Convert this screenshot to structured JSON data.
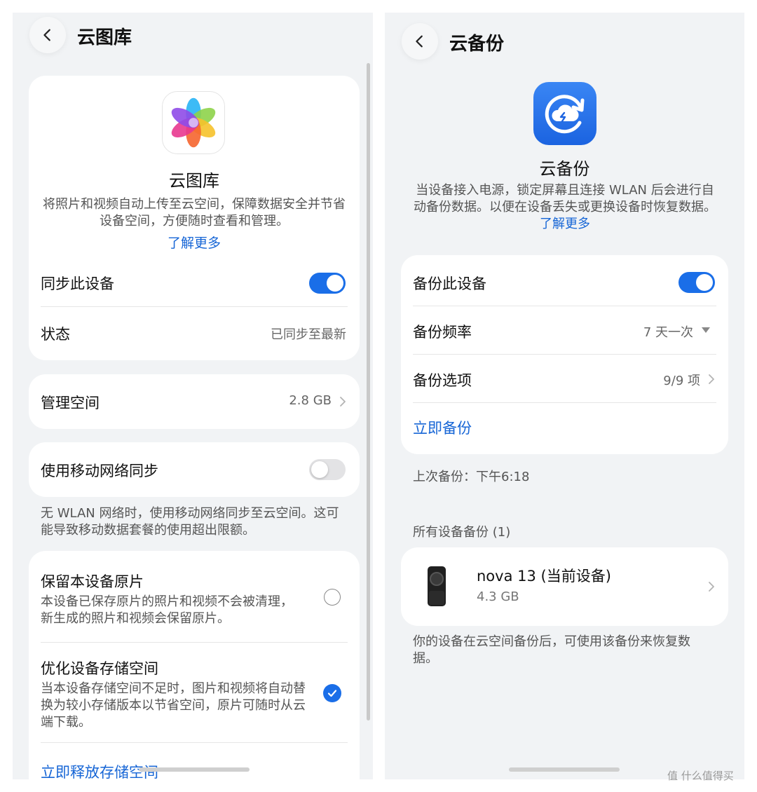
{
  "left": {
    "header": {
      "title": "云图库"
    },
    "app": {
      "name": "云图库",
      "icon": "gallery-flower-icon",
      "description": "将照片和视频自动上传至云空间，保障数据安全并节省设备空间，方便随时查看和管理。",
      "learn_more": "了解更多"
    },
    "sync": {
      "label": "同步此设备",
      "enabled": true
    },
    "status": {
      "label": "状态",
      "value": "已同步至最新"
    },
    "manage_space": {
      "label": "管理空间",
      "value": "2.8 GB"
    },
    "mobile_sync": {
      "label": "使用移动网络同步",
      "enabled": false,
      "note": "无 WLAN 网络时，使用移动网络同步至云空间。这可能导致移动数据套餐的使用超出限额。"
    },
    "keep_original": {
      "title": "保留本设备原片",
      "desc": "本设备已保存原片的照片和视频不会被清理，新生成的照片和视频会保留原片。",
      "selected": false
    },
    "optimize_storage": {
      "title": "优化设备存储空间",
      "desc": "当本设备存储空间不足时，图片和视频将自动替换为较小存储版本以节省空间，原片可随时从云端下载。",
      "selected": true
    },
    "release_action": "立即释放存储空间"
  },
  "right": {
    "header": {
      "title": "云备份"
    },
    "app": {
      "name": "云备份",
      "icon": "cloud-backup-icon",
      "description": "当设备接入电源，锁定屏幕且连接 WLAN 后会进行自动备份数据。以便在设备丢失或更换设备时恢复数据。",
      "learn_more": "了解更多"
    },
    "backup": {
      "label": "备份此设备",
      "enabled": true
    },
    "frequency": {
      "label": "备份频率",
      "value": "7 天一次"
    },
    "options": {
      "label": "备份选项",
      "value": "9/9 项"
    },
    "backup_now": "立即备份",
    "last_backup": "上次备份：下午6:18",
    "all_devices": "所有设备备份 (1)",
    "device": {
      "name": "nova 13 (当前设备)",
      "size": "4.3 GB",
      "icon": "phone-icon"
    },
    "restore_note": "你的设备在云空间备份后，可使用该备份来恢复数据。"
  },
  "watermark": "值 什么值得买",
  "colors": {
    "accent": "#1a6ee8",
    "link": "#1766d6",
    "background": "#f1f3f5",
    "card": "#ffffff"
  }
}
